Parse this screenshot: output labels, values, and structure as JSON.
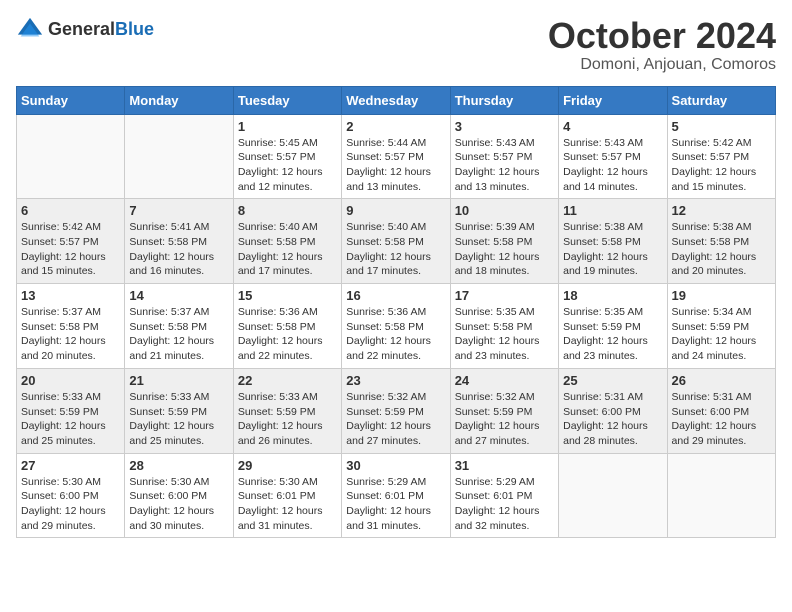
{
  "logo": {
    "general": "General",
    "blue": "Blue"
  },
  "header": {
    "month": "October 2024",
    "location": "Domoni, Anjouan, Comoros"
  },
  "weekdays": [
    "Sunday",
    "Monday",
    "Tuesday",
    "Wednesday",
    "Thursday",
    "Friday",
    "Saturday"
  ],
  "weeks": [
    [
      {
        "day": "",
        "info": ""
      },
      {
        "day": "",
        "info": ""
      },
      {
        "day": "1",
        "info": "Sunrise: 5:45 AM\nSunset: 5:57 PM\nDaylight: 12 hours\nand 12 minutes."
      },
      {
        "day": "2",
        "info": "Sunrise: 5:44 AM\nSunset: 5:57 PM\nDaylight: 12 hours\nand 13 minutes."
      },
      {
        "day": "3",
        "info": "Sunrise: 5:43 AM\nSunset: 5:57 PM\nDaylight: 12 hours\nand 13 minutes."
      },
      {
        "day": "4",
        "info": "Sunrise: 5:43 AM\nSunset: 5:57 PM\nDaylight: 12 hours\nand 14 minutes."
      },
      {
        "day": "5",
        "info": "Sunrise: 5:42 AM\nSunset: 5:57 PM\nDaylight: 12 hours\nand 15 minutes."
      }
    ],
    [
      {
        "day": "6",
        "info": "Sunrise: 5:42 AM\nSunset: 5:57 PM\nDaylight: 12 hours\nand 15 minutes."
      },
      {
        "day": "7",
        "info": "Sunrise: 5:41 AM\nSunset: 5:58 PM\nDaylight: 12 hours\nand 16 minutes."
      },
      {
        "day": "8",
        "info": "Sunrise: 5:40 AM\nSunset: 5:58 PM\nDaylight: 12 hours\nand 17 minutes."
      },
      {
        "day": "9",
        "info": "Sunrise: 5:40 AM\nSunset: 5:58 PM\nDaylight: 12 hours\nand 17 minutes."
      },
      {
        "day": "10",
        "info": "Sunrise: 5:39 AM\nSunset: 5:58 PM\nDaylight: 12 hours\nand 18 minutes."
      },
      {
        "day": "11",
        "info": "Sunrise: 5:38 AM\nSunset: 5:58 PM\nDaylight: 12 hours\nand 19 minutes."
      },
      {
        "day": "12",
        "info": "Sunrise: 5:38 AM\nSunset: 5:58 PM\nDaylight: 12 hours\nand 20 minutes."
      }
    ],
    [
      {
        "day": "13",
        "info": "Sunrise: 5:37 AM\nSunset: 5:58 PM\nDaylight: 12 hours\nand 20 minutes."
      },
      {
        "day": "14",
        "info": "Sunrise: 5:37 AM\nSunset: 5:58 PM\nDaylight: 12 hours\nand 21 minutes."
      },
      {
        "day": "15",
        "info": "Sunrise: 5:36 AM\nSunset: 5:58 PM\nDaylight: 12 hours\nand 22 minutes."
      },
      {
        "day": "16",
        "info": "Sunrise: 5:36 AM\nSunset: 5:58 PM\nDaylight: 12 hours\nand 22 minutes."
      },
      {
        "day": "17",
        "info": "Sunrise: 5:35 AM\nSunset: 5:58 PM\nDaylight: 12 hours\nand 23 minutes."
      },
      {
        "day": "18",
        "info": "Sunrise: 5:35 AM\nSunset: 5:59 PM\nDaylight: 12 hours\nand 23 minutes."
      },
      {
        "day": "19",
        "info": "Sunrise: 5:34 AM\nSunset: 5:59 PM\nDaylight: 12 hours\nand 24 minutes."
      }
    ],
    [
      {
        "day": "20",
        "info": "Sunrise: 5:33 AM\nSunset: 5:59 PM\nDaylight: 12 hours\nand 25 minutes."
      },
      {
        "day": "21",
        "info": "Sunrise: 5:33 AM\nSunset: 5:59 PM\nDaylight: 12 hours\nand 25 minutes."
      },
      {
        "day": "22",
        "info": "Sunrise: 5:33 AM\nSunset: 5:59 PM\nDaylight: 12 hours\nand 26 minutes."
      },
      {
        "day": "23",
        "info": "Sunrise: 5:32 AM\nSunset: 5:59 PM\nDaylight: 12 hours\nand 27 minutes."
      },
      {
        "day": "24",
        "info": "Sunrise: 5:32 AM\nSunset: 5:59 PM\nDaylight: 12 hours\nand 27 minutes."
      },
      {
        "day": "25",
        "info": "Sunrise: 5:31 AM\nSunset: 6:00 PM\nDaylight: 12 hours\nand 28 minutes."
      },
      {
        "day": "26",
        "info": "Sunrise: 5:31 AM\nSunset: 6:00 PM\nDaylight: 12 hours\nand 29 minutes."
      }
    ],
    [
      {
        "day": "27",
        "info": "Sunrise: 5:30 AM\nSunset: 6:00 PM\nDaylight: 12 hours\nand 29 minutes."
      },
      {
        "day": "28",
        "info": "Sunrise: 5:30 AM\nSunset: 6:00 PM\nDaylight: 12 hours\nand 30 minutes."
      },
      {
        "day": "29",
        "info": "Sunrise: 5:30 AM\nSunset: 6:01 PM\nDaylight: 12 hours\nand 31 minutes."
      },
      {
        "day": "30",
        "info": "Sunrise: 5:29 AM\nSunset: 6:01 PM\nDaylight: 12 hours\nand 31 minutes."
      },
      {
        "day": "31",
        "info": "Sunrise: 5:29 AM\nSunset: 6:01 PM\nDaylight: 12 hours\nand 32 minutes."
      },
      {
        "day": "",
        "info": ""
      },
      {
        "day": "",
        "info": ""
      }
    ]
  ]
}
